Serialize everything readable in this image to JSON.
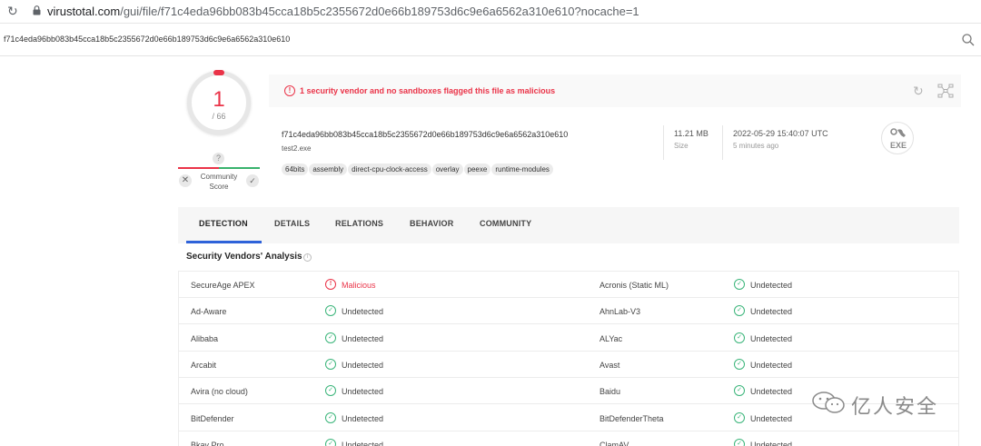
{
  "browser": {
    "url_host": "virustotal.com",
    "url_path": "/gui/file/f71c4eda96bb083b45cca18b5c2355672d0e66b189753d6c9e6a6562a310e610?nocache=1"
  },
  "search": {
    "query": "f71c4eda96bb083b45cca18b5c2355672d0e66b189753d6c9e6a6562a310e610"
  },
  "score": {
    "detections": "1",
    "total": "/ 66",
    "unknown_badge": "?",
    "community_label_1": "Community",
    "community_label_2": "Score",
    "downvote": "✕",
    "upvote": "✓"
  },
  "banner": {
    "message": "1 security vendor and no sandboxes flagged this file as malicious",
    "alert_glyph": "!"
  },
  "file": {
    "hash": "f71c4eda96bb083b45cca18b5c2355672d0e66b189753d6c9e6a6562a310e610",
    "name": "test2.exe",
    "tags": [
      "64bits",
      "assembly",
      "direct-cpu-clock-access",
      "overlay",
      "peexe",
      "runtime-modules"
    ],
    "size_value": "11.21 MB",
    "size_label": "Size",
    "date_value": "2022-05-29 15:40:07 UTC",
    "date_label": "5 minutes ago",
    "type_badge": "EXE"
  },
  "tabs": [
    {
      "label": "DETECTION",
      "active": true
    },
    {
      "label": "DETAILS",
      "active": false
    },
    {
      "label": "RELATIONS",
      "active": false
    },
    {
      "label": "BEHAVIOR",
      "active": false
    },
    {
      "label": "COMMUNITY",
      "active": false
    }
  ],
  "analysis": {
    "heading": "Security Vendors' Analysis",
    "info_glyph": "i",
    "rows": [
      {
        "v1": "SecureAge APEX",
        "r1": "Malicious",
        "m1": true,
        "v2": "Acronis (Static ML)",
        "r2": "Undetected",
        "m2": false
      },
      {
        "v1": "Ad-Aware",
        "r1": "Undetected",
        "m1": false,
        "v2": "AhnLab-V3",
        "r2": "Undetected",
        "m2": false
      },
      {
        "v1": "Alibaba",
        "r1": "Undetected",
        "m1": false,
        "v2": "ALYac",
        "r2": "Undetected",
        "m2": false
      },
      {
        "v1": "Arcabit",
        "r1": "Undetected",
        "m1": false,
        "v2": "Avast",
        "r2": "Undetected",
        "m2": false
      },
      {
        "v1": "Avira (no cloud)",
        "r1": "Undetected",
        "m1": false,
        "v2": "Baidu",
        "r2": "Undetected",
        "m2": false
      },
      {
        "v1": "BitDefender",
        "r1": "Undetected",
        "m1": false,
        "v2": "BitDefenderTheta",
        "r2": "Undetected",
        "m2": false
      },
      {
        "v1": "Bkav Pro",
        "r1": "Undetected",
        "m1": false,
        "v2": "ClamAV",
        "r2": "Undetected",
        "m2": false
      }
    ]
  },
  "watermark": {
    "text": "亿人安全"
  },
  "colors": {
    "malicious": "#ea3348",
    "clean": "#3bb57a",
    "tab_accent": "#2e62d9"
  }
}
